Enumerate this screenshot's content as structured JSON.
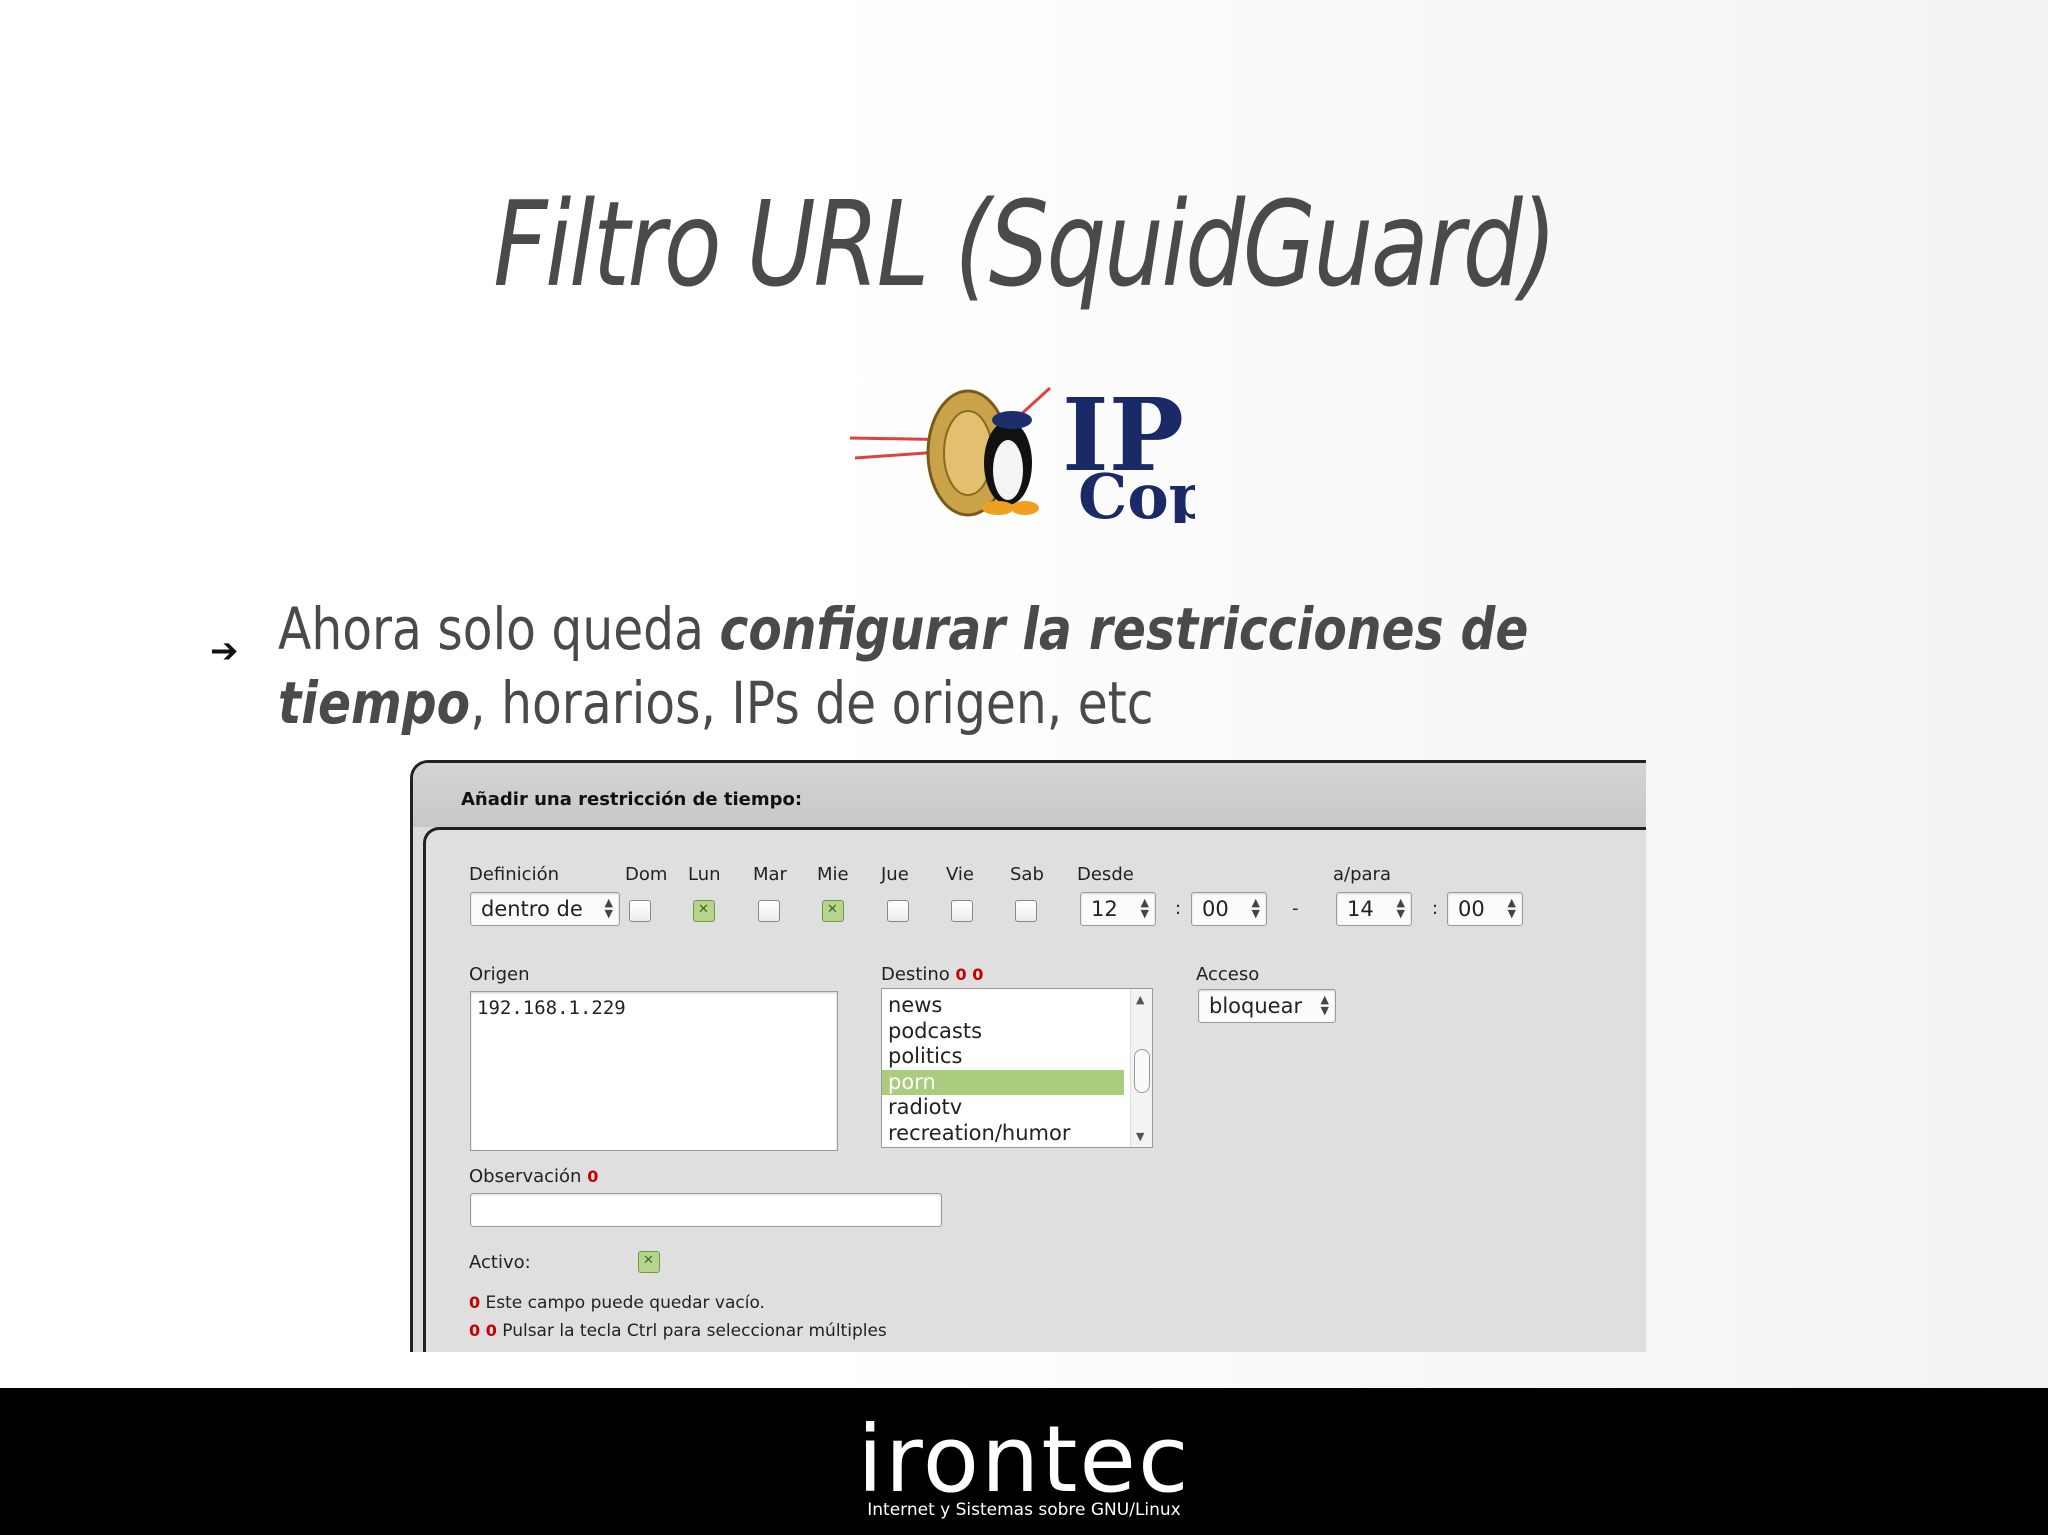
{
  "slide": {
    "title": "Filtro URL (SquidGuard)",
    "bullet_arrow": "➔",
    "bullet_prefix": "Ahora solo queda ",
    "bullet_emphasis": "configurar la restricciones de tiempo",
    "bullet_suffix": ", horarios, IPs de origen, etc"
  },
  "logo": {
    "text": "IPCop",
    "icon": "ipcop-logo"
  },
  "form": {
    "header": "Añadir una restricción de tiempo:",
    "definicion": {
      "label": "Definición",
      "value": "dentro de"
    },
    "days": [
      {
        "label": "Dom",
        "checked": false
      },
      {
        "label": "Lun",
        "checked": true
      },
      {
        "label": "Mar",
        "checked": false
      },
      {
        "label": "Mie",
        "checked": true
      },
      {
        "label": "Jue",
        "checked": false
      },
      {
        "label": "Vie",
        "checked": false
      },
      {
        "label": "Sab",
        "checked": false
      }
    ],
    "desde": {
      "label": "Desde",
      "hour": "12",
      "minute": "00"
    },
    "separator_colon": ":",
    "separator_dash": "-",
    "apara": {
      "label": "a/para",
      "hour": "14",
      "minute": "00"
    },
    "origen": {
      "label": "Origen",
      "value": "192.168.1.229"
    },
    "destino": {
      "label": "Destino",
      "marker": "0 0",
      "items": [
        "news",
        "podcasts",
        "politics",
        "porn",
        "radiotv",
        "recreation/humor"
      ],
      "selected_index": 3
    },
    "acceso": {
      "label": "Acceso",
      "value": "bloquear"
    },
    "observacion": {
      "label": "Observación",
      "marker": "0",
      "value": ""
    },
    "activo": {
      "label": "Activo:",
      "checked": true
    },
    "notes": [
      {
        "marker": "0",
        "text": "Este campo puede quedar vacío."
      },
      {
        "marker": "0 0",
        "text": "Pulsar la tecla Ctrl para seleccionar múltiples"
      }
    ]
  },
  "footer": {
    "brand": "irontec",
    "tagline": "Internet y Sistemas sobre GNU/Linux"
  }
}
